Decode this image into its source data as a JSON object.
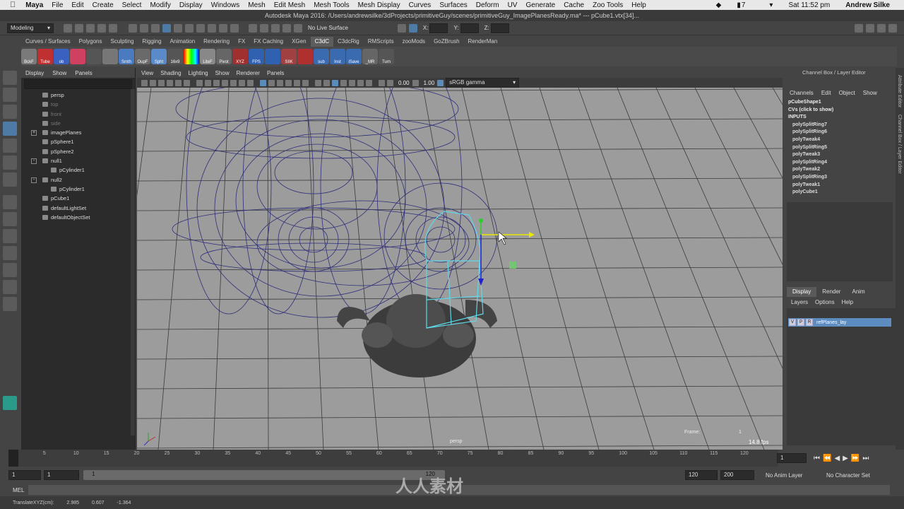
{
  "mac_menu": {
    "apple": "",
    "app": "Maya",
    "items": [
      "File",
      "Edit",
      "Create",
      "Select",
      "Modify",
      "Display",
      "Windows",
      "Mesh",
      "Edit Mesh",
      "Mesh Tools",
      "Mesh Display",
      "Curves",
      "Surfaces",
      "Deform",
      "UV",
      "Generate",
      "Cache",
      "Zoo Tools",
      "Help"
    ],
    "battery": "7",
    "clock": "Sat 11:52 pm",
    "user": "Andrew Silke"
  },
  "title": "Autodesk Maya 2016: /Users/andrewsilke/3dProjects/primitiveGuy/scenes/primitiveGuy_ImagePlanesReady.ma*  ---  pCube1.vtx[34]...",
  "status_line": {
    "mode": "Modeling",
    "live_surface": "No Live Surface",
    "x_label": "X:",
    "y_label": "Y:",
    "z_label": "Z:"
  },
  "shelf_tabs": [
    "Curves / Surfaces",
    "Polygons",
    "Sculpting",
    "Rigging",
    "Animation",
    "Rendering",
    "FX",
    "FX Caching",
    "XGen",
    "C3dC",
    "C3dcRig",
    "RMScripts",
    "zooMods",
    "GoZBrush",
    "RenderMan"
  ],
  "shelf_active": "C3dC",
  "shelf_buttons": [
    "BckF",
    "Tube",
    "ob",
    "",
    "",
    "",
    "Smth",
    "OupF",
    "Spht",
    "16x9",
    "",
    "LiteF",
    "Pivot",
    "XYZ",
    "FPS",
    "",
    "SIIK",
    "",
    "sub",
    "Inst",
    "iSave",
    "_MR",
    "Turn"
  ],
  "outliner": {
    "menu": [
      "Display",
      "Show",
      "Panels"
    ],
    "items": [
      {
        "label": "persp",
        "dim": false,
        "indent": 0,
        "expand": ""
      },
      {
        "label": "top",
        "dim": true,
        "indent": 0,
        "expand": ""
      },
      {
        "label": "front",
        "dim": true,
        "indent": 0,
        "expand": ""
      },
      {
        "label": "side",
        "dim": true,
        "indent": 0,
        "expand": ""
      },
      {
        "label": "imagePlanes",
        "dim": false,
        "indent": 0,
        "expand": "+"
      },
      {
        "label": "pSphere1",
        "dim": false,
        "indent": 0,
        "expand": ""
      },
      {
        "label": "pSphere2",
        "dim": false,
        "indent": 0,
        "expand": ""
      },
      {
        "label": "null1",
        "dim": false,
        "indent": 0,
        "expand": "-"
      },
      {
        "label": "pCylinder1",
        "dim": false,
        "indent": 1,
        "expand": ""
      },
      {
        "label": "null2",
        "dim": false,
        "indent": 0,
        "expand": "-"
      },
      {
        "label": "pCylinder1",
        "dim": false,
        "indent": 1,
        "expand": ""
      },
      {
        "label": "pCube1",
        "dim": false,
        "indent": 0,
        "expand": ""
      },
      {
        "label": "defaultLightSet",
        "dim": false,
        "indent": 0,
        "expand": ""
      },
      {
        "label": "defaultObjectSet",
        "dim": false,
        "indent": 0,
        "expand": ""
      }
    ]
  },
  "viewport": {
    "menu": [
      "View",
      "Shading",
      "Lighting",
      "Show",
      "Renderer",
      "Panels"
    ],
    "exposure": "0.00",
    "gamma": "1.00",
    "color_space": "sRGB gamma",
    "camera_label": "persp",
    "frame_label": "Frame:",
    "frame_value": "1",
    "fps": "14.8 fps"
  },
  "channel_box": {
    "title": "Channel Box / Layer Editor",
    "menu": [
      "Channels",
      "Edit",
      "Object",
      "Show"
    ],
    "shape": "pCubeShape1",
    "cvs": "CVs (click to show)",
    "inputs_label": "INPUTS",
    "inputs": [
      "polySplitRing7",
      "polySplitRing6",
      "polyTweak4",
      "polySplitRing5",
      "polyTweak3",
      "polySplitRing4",
      "polyTweak2",
      "polySplitRing3",
      "polyTweak1",
      "polyCube1"
    ]
  },
  "layer_editor": {
    "tabs": [
      "Display",
      "Render",
      "Anim"
    ],
    "active_tab": "Display",
    "menu": [
      "Layers",
      "Options",
      "Help"
    ],
    "layer": {
      "v": "V",
      "p": "P",
      "r": "R",
      "name": "refPlanes_lay"
    }
  },
  "side_tabs": [
    "Attribute Editor",
    "Channel Box / Layer Editor"
  ],
  "timeline": {
    "ticks": [
      "1",
      "5",
      "10",
      "15",
      "20",
      "25",
      "30",
      "35",
      "40",
      "45",
      "50",
      "55",
      "60",
      "65",
      "70",
      "75",
      "80",
      "85",
      "90",
      "95",
      "100",
      "105",
      "110",
      "115",
      "120"
    ],
    "current_frame": "1"
  },
  "range": {
    "start": "1",
    "playback_start": "1",
    "slider_start": "1",
    "slider_end": "120",
    "playback_end": "120",
    "end": "200",
    "anim_layer": "No Anim Layer",
    "char_set": "No Character Set"
  },
  "cmd": {
    "label": "MEL"
  },
  "help_line": {
    "label": "TranslateXYZ(cm):",
    "x": "2.985",
    "y": "0.607",
    "z": "-1.364"
  },
  "watermark": "人人素材"
}
